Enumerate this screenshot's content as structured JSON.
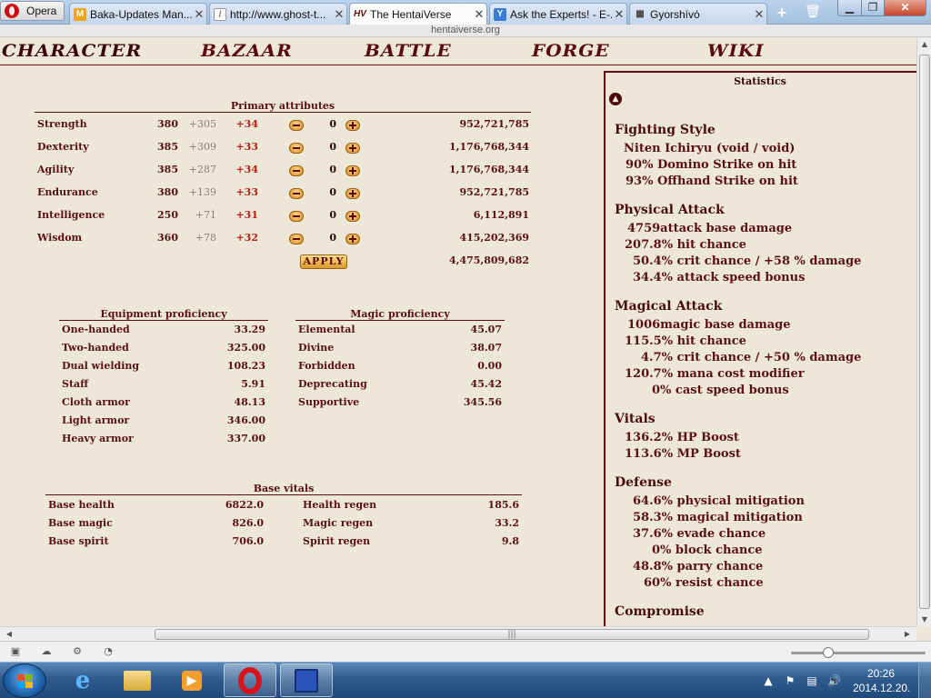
{
  "browser": {
    "menu_label": "Opera",
    "tabs": [
      {
        "label": "Baka-Updates Man...",
        "favicon": "M",
        "active": false
      },
      {
        "label": "http://www.ghost-t...",
        "favicon": "page",
        "active": false
      },
      {
        "label": "The HentaiVerse",
        "favicon": "HV",
        "active": true
      },
      {
        "label": "Ask the Experts! - E-...",
        "favicon": "Y",
        "active": false
      },
      {
        "label": "Gyorshívó",
        "favicon": "grid",
        "active": false
      }
    ],
    "address": "hentaiverse.org"
  },
  "nav": {
    "items": [
      "CHARACTER",
      "BAZAAR",
      "BATTLE",
      "FORGE",
      "WIKI"
    ]
  },
  "primary": {
    "title": "Primary attributes",
    "rows": [
      {
        "name": "Strength",
        "base": "380",
        "bonus": "+305",
        "mod": "+34",
        "alloc": "0",
        "exp": "952,721,785"
      },
      {
        "name": "Dexterity",
        "base": "385",
        "bonus": "+309",
        "mod": "+33",
        "alloc": "0",
        "exp": "1,176,768,344"
      },
      {
        "name": "Agility",
        "base": "385",
        "bonus": "+287",
        "mod": "+34",
        "alloc": "0",
        "exp": "1,176,768,344"
      },
      {
        "name": "Endurance",
        "base": "380",
        "bonus": "+139",
        "mod": "+33",
        "alloc": "0",
        "exp": "952,721,785"
      },
      {
        "name": "Intelligence",
        "base": "250",
        "bonus": "+71",
        "mod": "+31",
        "alloc": "0",
        "exp": "6,112,891"
      },
      {
        "name": "Wisdom",
        "base": "360",
        "bonus": "+78",
        "mod": "+32",
        "alloc": "0",
        "exp": "415,202,369"
      }
    ],
    "apply_label": "APPLY",
    "total_exp": "4,475,809,682"
  },
  "equipment": {
    "title": "Equipment proficiency",
    "rows": [
      {
        "name": "One-handed",
        "value": "33.29"
      },
      {
        "name": "Two-handed",
        "value": "325.00"
      },
      {
        "name": "Dual wielding",
        "value": "108.23"
      },
      {
        "name": "Staff",
        "value": "5.91"
      },
      {
        "name": "Cloth armor",
        "value": "48.13"
      },
      {
        "name": "Light armor",
        "value": "346.00"
      },
      {
        "name": "Heavy armor",
        "value": "337.00"
      }
    ]
  },
  "magic": {
    "title": "Magic proficiency",
    "rows": [
      {
        "name": "Elemental",
        "value": "45.07"
      },
      {
        "name": "Divine",
        "value": "38.07"
      },
      {
        "name": "Forbidden",
        "value": "0.00"
      },
      {
        "name": "Deprecating",
        "value": "45.42"
      },
      {
        "name": "Supportive",
        "value": "345.56"
      }
    ]
  },
  "vitals": {
    "title": "Base vitals",
    "left": [
      {
        "name": "Base health",
        "value": "6822.0"
      },
      {
        "name": "Base magic",
        "value": "826.0"
      },
      {
        "name": "Base spirit",
        "value": "706.0"
      }
    ],
    "right": [
      {
        "name": "Health regen",
        "value": "185.6"
      },
      {
        "name": "Magic regen",
        "value": "33.2"
      },
      {
        "name": "Spirit regen",
        "value": "9.8"
      }
    ]
  },
  "stats": {
    "title": "Statistics",
    "fighting_style": {
      "head": "Fighting Style",
      "lines": [
        "Niten Ichiryu (void / void)",
        "90% Domino Strike on hit",
        "93% Offhand Strike on hit"
      ]
    },
    "physical": {
      "head": "Physical Attack",
      "lines": [
        "4759attack base damage",
        "207.8% hit chance",
        "50.4% crit chance / +58 % damage",
        "34.4% attack speed bonus"
      ]
    },
    "magical": {
      "head": "Magical Attack",
      "lines": [
        "1006magic base damage",
        "115.5% hit chance",
        "4.7% crit chance / +50 % damage",
        "120.7% mana cost modifier",
        "0% cast speed bonus"
      ]
    },
    "vitals": {
      "head": "Vitals",
      "lines": [
        "136.2% HP Boost",
        "113.6% MP Boost"
      ]
    },
    "defense": {
      "head": "Defense",
      "lines": [
        "64.6% physical mitigation",
        "58.3% magical mitigation",
        "37.6% evade chance",
        "0% block chance",
        "48.8% parry chance",
        "60% resist chance"
      ]
    },
    "compromise": {
      "head": "Compromise"
    }
  },
  "taskbar": {
    "time": "20:26",
    "date": "2014.12.20."
  },
  "colors": {
    "page_bg": "#ede7d7",
    "text_maroon": "#5b1010",
    "mod_red": "#b5201b",
    "bonus_grey": "#8a7f78"
  }
}
